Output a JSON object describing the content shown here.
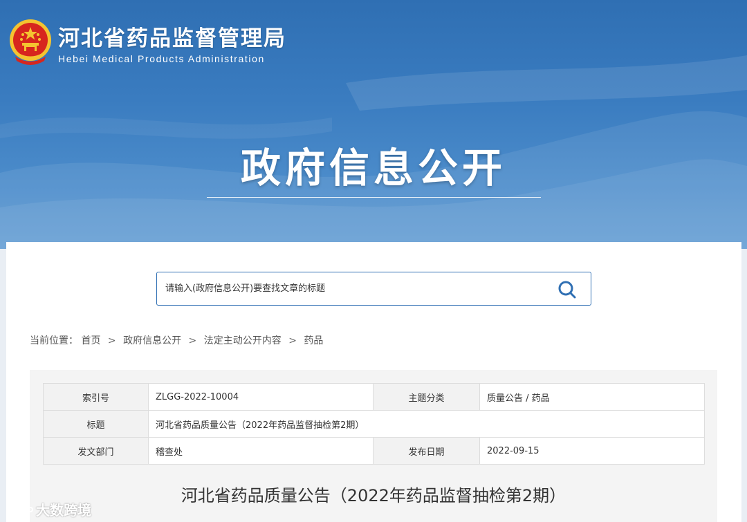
{
  "header": {
    "site_name_cn": "河北省药品监督管理局",
    "site_name_en": "Hebei Medical Products Administration",
    "section_title": "政府信息公开",
    "emblem_icon": "national-emblem-icon"
  },
  "search": {
    "placeholder": "请输入(政府信息公开)要查找文章的标题",
    "icon": "search-icon"
  },
  "breadcrumb": {
    "prefix": "当前位置：",
    "items": [
      "首页",
      "政府信息公开",
      "法定主动公开内容",
      "药品"
    ],
    "separator": ">"
  },
  "meta_table": {
    "index_no_label": "索引号",
    "index_no_value": "ZLGG-2022-10004",
    "category_label": "主题分类",
    "category_value": "质量公告 / 药品",
    "title_label": "标题",
    "title_value": "河北省药品质量公告（2022年药品监督抽检第2期）",
    "dept_label": "发文部门",
    "dept_value": "稽查处",
    "date_label": "发布日期",
    "date_value": "2022-09-15"
  },
  "article": {
    "title": "河北省药品质量公告（2022年药品监督抽检第2期）"
  },
  "watermark": {
    "text": "大数跨境"
  },
  "colors": {
    "banner": "#3a7cc0",
    "accent": "#2f6fb3",
    "emblem_red": "#d7261e",
    "emblem_gold": "#f4c430"
  }
}
